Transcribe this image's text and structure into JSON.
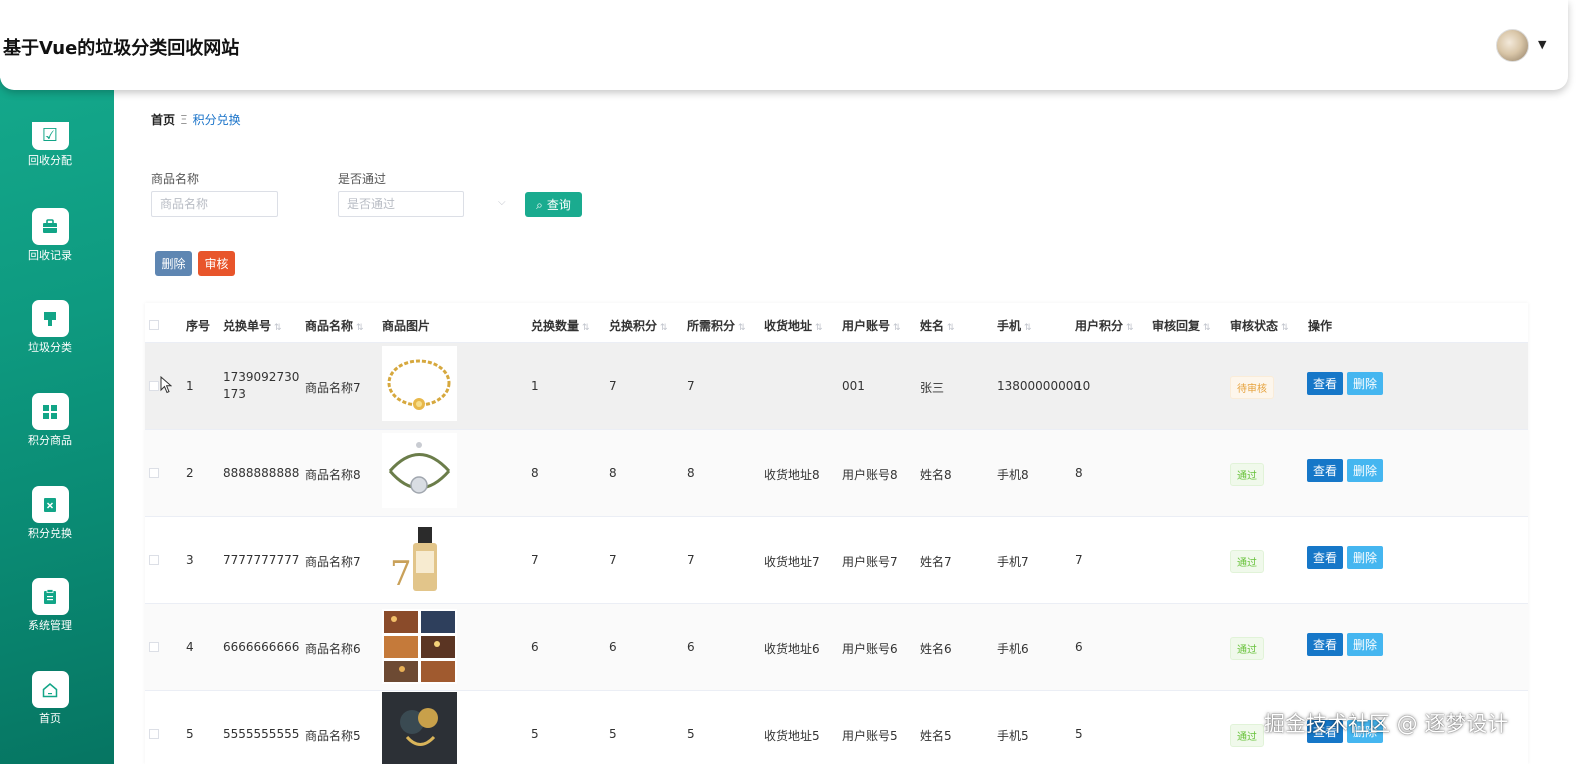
{
  "header": {
    "title": "基于Vue的垃圾分类回收网站"
  },
  "sidebar": {
    "items": [
      {
        "label": "回收分配",
        "icon": "check-square-icon"
      },
      {
        "label": "回收记录",
        "icon": "briefcase-icon"
      },
      {
        "label": "垃圾分类",
        "icon": "brush-icon"
      },
      {
        "label": "积分商品",
        "icon": "grid-icon"
      },
      {
        "label": "积分兑换",
        "icon": "document-x-icon"
      },
      {
        "label": "系统管理",
        "icon": "clipboard-icon"
      },
      {
        "label": "首页",
        "icon": "home-icon"
      }
    ]
  },
  "breadcrumb": {
    "home": "首页",
    "separator": "Ξ",
    "current": "积分兑换"
  },
  "search": {
    "name_label": "商品名称",
    "name_placeholder": "商品名称",
    "pass_label": "是否通过",
    "pass_placeholder": "是否通过",
    "query_button": "查询"
  },
  "actions": {
    "delete": "删除",
    "audit": "审核"
  },
  "table": {
    "columns": [
      "序号",
      "兑换单号",
      "商品名称",
      "商品图片",
      "兑换数量",
      "兑换积分",
      "所需积分",
      "收货地址",
      "用户账号",
      "姓名",
      "手机",
      "用户积分",
      "审核回复",
      "审核状态",
      "操作"
    ],
    "view_label": "查看",
    "delete_label": "删除",
    "rows": [
      {
        "index": "1",
        "order_no": "1739092730173",
        "product": "商品名称7",
        "qty": "1",
        "points": "7",
        "required": "7",
        "address": "",
        "account": "001",
        "name": "张三",
        "phone": "13800000000",
        "user_points": "10",
        "reply": "",
        "status": "待审核"
      },
      {
        "index": "2",
        "order_no": "8888888888",
        "product": "商品名称8",
        "qty": "8",
        "points": "8",
        "required": "8",
        "address": "收货地址8",
        "account": "用户账号8",
        "name": "姓名8",
        "phone": "手机8",
        "user_points": "8",
        "reply": "",
        "status": "通过"
      },
      {
        "index": "3",
        "order_no": "7777777777",
        "product": "商品名称7",
        "qty": "7",
        "points": "7",
        "required": "7",
        "address": "收货地址7",
        "account": "用户账号7",
        "name": "姓名7",
        "phone": "手机7",
        "user_points": "7",
        "reply": "",
        "status": "通过"
      },
      {
        "index": "4",
        "order_no": "6666666666",
        "product": "商品名称6",
        "qty": "6",
        "points": "6",
        "required": "6",
        "address": "收货地址6",
        "account": "用户账号6",
        "name": "姓名6",
        "phone": "手机6",
        "user_points": "6",
        "reply": "",
        "status": "通过"
      },
      {
        "index": "5",
        "order_no": "5555555555",
        "product": "商品名称5",
        "qty": "5",
        "points": "5",
        "required": "5",
        "address": "收货地址5",
        "account": "用户账号5",
        "name": "姓名5",
        "phone": "手机5",
        "user_points": "5",
        "reply": "",
        "status": "通过"
      }
    ]
  },
  "watermark": "掘金技术社区 @ 逐梦设计",
  "colors": {
    "primary": "#1aab8f",
    "sidebar": "#0e9a80",
    "audit": "#e8552b",
    "view": "#1677c8",
    "delete": "#45b6f0"
  }
}
